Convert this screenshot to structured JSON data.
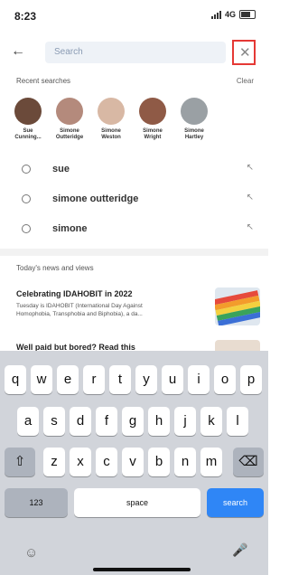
{
  "status_bar": {
    "time": "8:23",
    "network": "4G"
  },
  "search": {
    "placeholder": "Search"
  },
  "recent": {
    "title": "Recent searches",
    "clear_label": "Clear",
    "people": [
      {
        "name_line1": "Sue",
        "name_line2": "Cunning...",
        "color": "#6b4a3a"
      },
      {
        "name_line1": "Simone",
        "name_line2": "Outteridge",
        "color": "#b48a7c"
      },
      {
        "name_line1": "Simone",
        "name_line2": "Weston",
        "color": "#d8b8a4"
      },
      {
        "name_line1": "Simone",
        "name_line2": "Wright",
        "color": "#8f5a46"
      },
      {
        "name_line1": "Simone",
        "name_line2": "Hartley",
        "color": "#9aa0a4"
      }
    ],
    "history": [
      "sue",
      "simone outteridge",
      "simone"
    ]
  },
  "news": {
    "title": "Today's news and views",
    "articles": [
      {
        "headline": "Celebrating IDAHOBIT in 2022",
        "line1": "Tuesday is IDAHOBIT (International Day Against",
        "line2": "Homophobia, Transphobia and Biphobia), a da..."
      },
      {
        "headline": "Well paid but bored? Read this"
      }
    ]
  },
  "keyboard": {
    "row1": [
      "q",
      "w",
      "e",
      "r",
      "t",
      "y",
      "u",
      "i",
      "o",
      "p"
    ],
    "row2": [
      "a",
      "s",
      "d",
      "f",
      "g",
      "h",
      "j",
      "k",
      "l"
    ],
    "row3": [
      "z",
      "x",
      "c",
      "v",
      "b",
      "n",
      "m"
    ],
    "numbers_label": "123",
    "space_label": "space",
    "action_label": "search"
  },
  "colors": {
    "accent": "#2f86f6",
    "highlight_border": "#e53935"
  }
}
